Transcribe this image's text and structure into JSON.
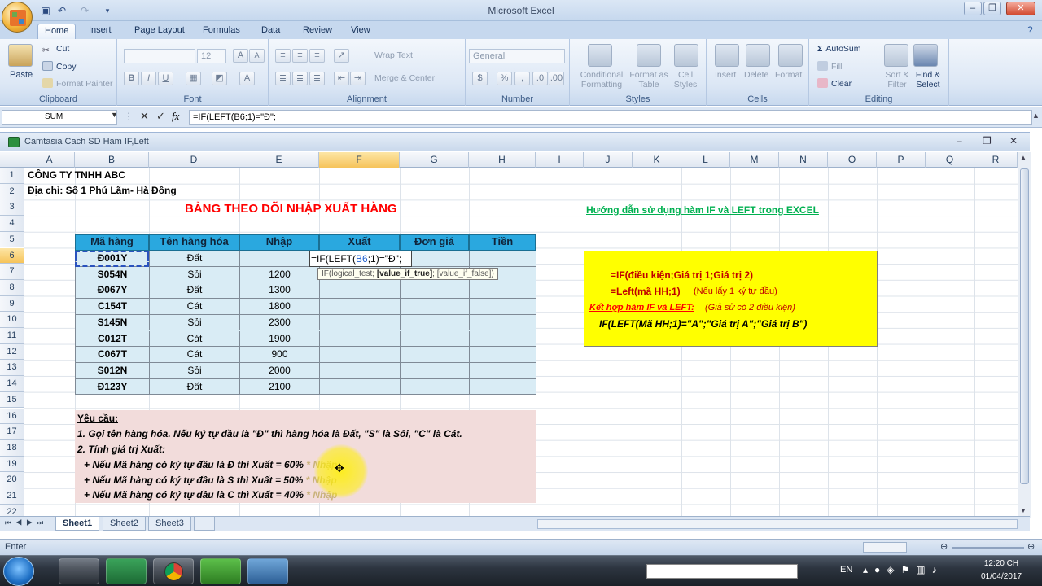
{
  "app_title": "Microsoft Excel",
  "tabs": [
    "Home",
    "Insert",
    "Page Layout",
    "Formulas",
    "Data",
    "Review",
    "View"
  ],
  "ribbon": {
    "clipboard": {
      "paste": "Paste",
      "cut": "Cut",
      "copy": "Copy",
      "format_painter": "Format Painter",
      "label": "Clipboard"
    },
    "font": {
      "size": "12",
      "label": "Font"
    },
    "alignment": {
      "wrap": "Wrap Text",
      "merge": "Merge & Center",
      "label": "Alignment"
    },
    "number": {
      "format": "General",
      "label": "Number"
    },
    "styles": {
      "cond": "Conditional Formatting",
      "table": "Format as Table",
      "cell": "Cell Styles",
      "label": "Styles"
    },
    "cells": {
      "insert": "Insert",
      "delete": "Delete",
      "format": "Format",
      "label": "Cells"
    },
    "editing": {
      "autosum": "AutoSum",
      "fill": "Fill",
      "clear": "Clear",
      "sort": "Sort & Filter",
      "find": "Find & Select",
      "label": "Editing"
    }
  },
  "formula_bar": {
    "name_box": "SUM",
    "formula": "=IF(LEFT(B6;1)=\"Đ\";"
  },
  "workbook_title": "Camtasia Cach SD Ham IF,Left",
  "columns": [
    "A",
    "B",
    "D",
    "E",
    "F",
    "G",
    "H",
    "I",
    "J",
    "K",
    "L",
    "M",
    "N",
    "O",
    "P",
    "Q",
    "R"
  ],
  "rows": [
    "1",
    "2",
    "3",
    "4",
    "5",
    "6",
    "7",
    "8",
    "9",
    "10",
    "11",
    "12",
    "13",
    "14",
    "15",
    "16",
    "17",
    "18",
    "19",
    "20",
    "21",
    "22"
  ],
  "company": "CÔNG TY TNHH ABC",
  "address": "Địa chỉ: Số 1 Phú Lãm- Hà Đông",
  "sheet_title": "BẢNG THEO DÕI NHẬP XUẤT HÀNG",
  "guide_link": "Hướng dẫn sử dụng hàm IF và LEFT trong EXCEL",
  "table": {
    "headers": [
      "Mã hàng",
      "Tên hàng hóa",
      "Nhập",
      "Xuất",
      "Đơn giá",
      "Tiền"
    ],
    "rows": [
      {
        "code": "Đ001Y",
        "name": "Đất",
        "nhap": ""
      },
      {
        "code": "S054N",
        "name": "Sỏi",
        "nhap": "1200"
      },
      {
        "code": "Đ067Y",
        "name": "Đất",
        "nhap": "1300"
      },
      {
        "code": "C154T",
        "name": "Cát",
        "nhap": "1800"
      },
      {
        "code": "S145N",
        "name": "Sỏi",
        "nhap": "2300"
      },
      {
        "code": "C012T",
        "name": "Cát",
        "nhap": "1900"
      },
      {
        "code": "C067T",
        "name": "Cát",
        "nhap": "900"
      },
      {
        "code": "S012N",
        "name": "Sỏi",
        "nhap": "2000"
      },
      {
        "code": "Đ123Y",
        "name": "Đất",
        "nhap": "2100"
      }
    ]
  },
  "editing_cell": {
    "prefix": "=IF(LEFT(",
    "ref": "B6",
    "suffix": ";1)=\"Đ\";"
  },
  "tooltip": {
    "a": "IF(logical_test; ",
    "b": "[value_if_true]",
    "c": "; [value_if_false])"
  },
  "yellow_box": {
    "line1": "=IF(điều kiện;Giá trị 1;Giá trị 2)",
    "line2a": "=Left(mã HH;1)",
    "line2b": "(Nếu lấy 1 ký tự đầu)",
    "line3a": "Kết hợp hàm IF và LEFT:",
    "line3b": "(Giả sử có 2 điều kiện)",
    "line4": "IF(LEFT(Mã HH;1)=\"A\";\"Giá trị A\";\"Giá trị B\")"
  },
  "requirements": {
    "title": "Yêu cầu:",
    "r1": "1. Gọi tên hàng hóa. Nếu ký tự đầu là \"Đ\" thì hàng hóa là Đất, \"S\" là Sỏi, \"C\" là Cát.",
    "r2": "2. Tính giá trị Xuất:",
    "r3a": "+ Nếu Mã hàng có ký tự đầu là Đ thì Xuất = 60%",
    "r3b": " * Nhập",
    "r4a": "+ Nếu Mã hàng có ký tự đầu là S thì Xuất = 50%",
    "r4b": " * Nhập",
    "r5a": "+ Nếu Mã hàng có ký tự đầu là C thì Xuất = 40%",
    "r5b": " * Nhập"
  },
  "sheets": [
    "Sheet1",
    "Sheet2",
    "Sheet3"
  ],
  "status": "Enter",
  "tray": {
    "lang": "EN",
    "time": "12:20 CH",
    "date": "01/04/2017"
  },
  "colors": {
    "table_header": "#2aa8df",
    "table_body": "#d9ecf5",
    "yellow": "#ffff00",
    "req_bg": "#f2dcdb",
    "title_red": "#ff0000",
    "link_green": "#00b050"
  }
}
